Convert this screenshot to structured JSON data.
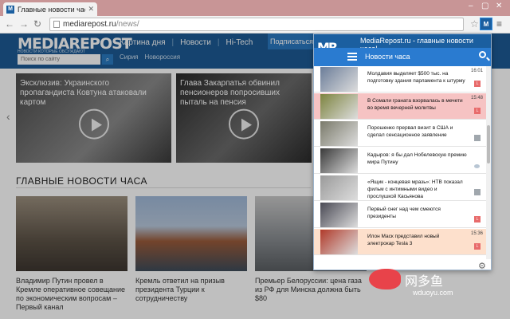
{
  "browser": {
    "tab_title": "Главные новости часа н",
    "tab_favicon": "M",
    "url_host": "mediarepost.ru",
    "url_path": "/news/",
    "ext_badge": "M"
  },
  "site": {
    "logo": "MEDIAREPOST",
    "logo_sub": "НОВОСТИ КОТОРЫЕ ОБСУЖДАЮТ",
    "search_placeholder": "Поиск по сайту",
    "nav": [
      "Картина дня",
      "Новости",
      "Hi-Tech"
    ],
    "subnav": [
      "Сирия",
      "Новороссия"
    ],
    "subscribe": "Подписаться",
    "heroes": [
      {
        "caption": "Эксклюзив: Украинского пропагандиста Ковтуна атаковали картом"
      },
      {
        "caption": "Глава Закарпатья обвинил пенсионеров попросивших пыталь на пенсия"
      }
    ],
    "section_title": "ГЛАВНЫЕ НОВОСТИ ЧАСА",
    "cards": [
      {
        "caption": "Владимир Путин провел в Кремле оперативное совещание по экономическим вопросам – Первый канал"
      },
      {
        "caption": "Кремль ответил на призыв президента Турции к сотрудничеству"
      },
      {
        "caption": "Премьер Белоруссии: цена газа из РФ для Минска должна быть $80"
      }
    ]
  },
  "popup": {
    "title": "MediaRepost.ru - главные новости часа!",
    "logo": "MR",
    "section": "Новости часа",
    "items": [
      {
        "text": "Молдавия выделяет $500 тыс. на подготовку здания парламента к штурму",
        "time": "16:01",
        "badge": "red",
        "highlight": "none",
        "thumb": "#6b7d99"
      },
      {
        "text": "В Сомали граната взорвалась в мечети во время вечерней молитвы",
        "time": "15:48",
        "badge": "red",
        "highlight": "#f6c3c3",
        "thumb": "#7d8440"
      },
      {
        "text": "Порошенко прервал визит в США и сделал сенсационное заявление",
        "time": "",
        "badge": "gray",
        "highlight": "none",
        "thumb": "#7a7a6a"
      },
      {
        "text": "Кадыров: я бы дал Нобелевскую премию мира Путину",
        "time": "",
        "badge": "round",
        "highlight": "none",
        "thumb": "#3a3a3a"
      },
      {
        "text": "«Ящик - концевая мразь»: НТВ показал фильм с интимными видео и прослушкой Касьянова",
        "time": "",
        "badge": "gray",
        "highlight": "none",
        "thumb": "#9a9a9a"
      },
      {
        "text": "Первый снег над чем смеются президенты",
        "time": "",
        "badge": "red",
        "highlight": "none",
        "thumb": "#4a4a55"
      },
      {
        "text": "Илон Маск представил новый электрокар Tesla 3",
        "time": "15:36",
        "badge": "red",
        "highlight": "#fde0cc",
        "thumb": "#b03a2a"
      }
    ]
  },
  "watermark": {
    "text": "网多鱼",
    "url": "wduoyu.com"
  }
}
